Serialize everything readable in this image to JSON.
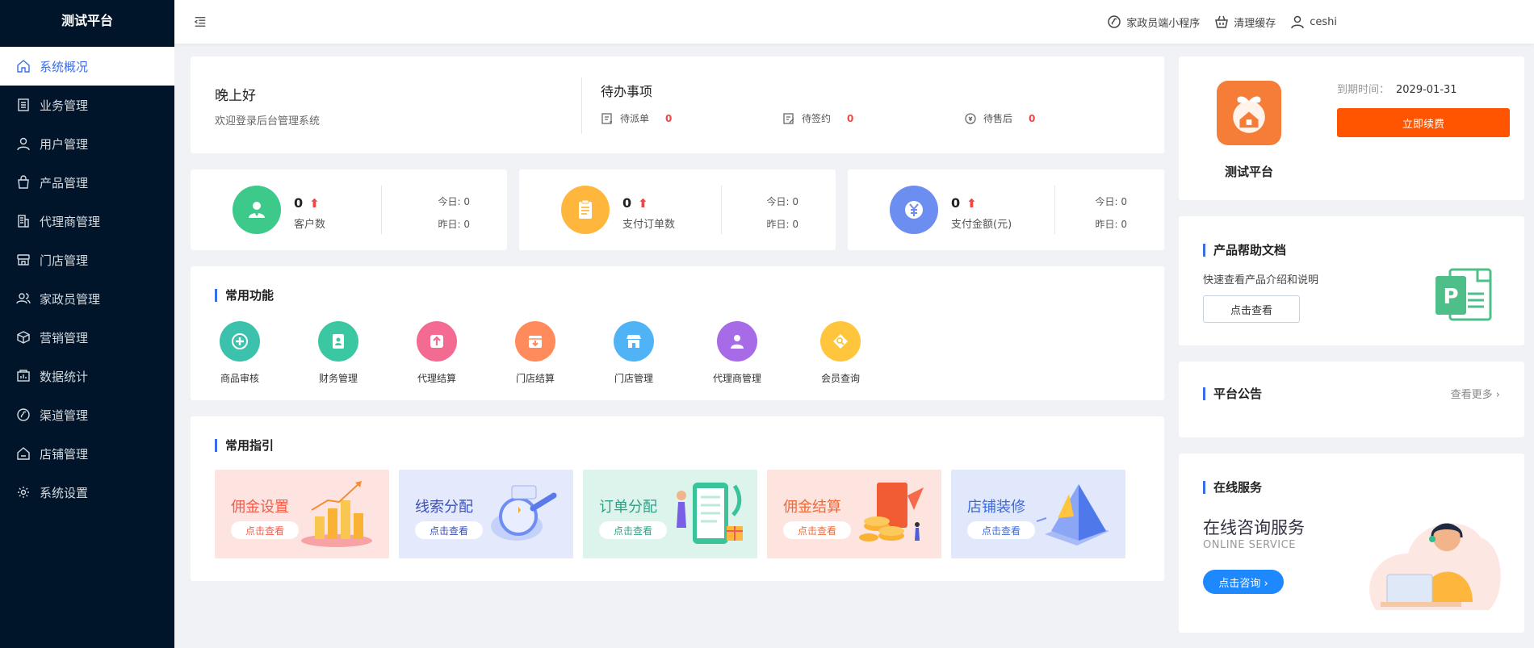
{
  "app": {
    "title": "测试平台"
  },
  "sidebar": {
    "items": [
      {
        "label": "系统概况",
        "icon": "home-icon",
        "active": true
      },
      {
        "label": "业务管理",
        "icon": "list-icon"
      },
      {
        "label": "用户管理",
        "icon": "user-icon"
      },
      {
        "label": "产品管理",
        "icon": "bag-icon"
      },
      {
        "label": "代理商管理",
        "icon": "building-icon"
      },
      {
        "label": "门店管理",
        "icon": "store-icon"
      },
      {
        "label": "家政员管理",
        "icon": "users-icon"
      },
      {
        "label": "营销管理",
        "icon": "cube-icon"
      },
      {
        "label": "数据统计",
        "icon": "chart-box-icon"
      },
      {
        "label": "渠道管理",
        "icon": "channel-icon"
      },
      {
        "label": "店铺管理",
        "icon": "shop-icon"
      },
      {
        "label": "系统设置",
        "icon": "gear-icon"
      }
    ]
  },
  "header": {
    "mini_program": "家政员端小程序",
    "clear_cache": "清理缓存",
    "user": "ceshi"
  },
  "welcome": {
    "greeting": "晚上好",
    "subtitle": "欢迎登录后台管理系统"
  },
  "todo": {
    "title": "待办事项",
    "items": [
      {
        "label": "待派单",
        "count": "0"
      },
      {
        "label": "待签约",
        "count": "0"
      },
      {
        "label": "待售后",
        "count": "0"
      }
    ]
  },
  "stats": [
    {
      "value": "0",
      "label": "客户数",
      "today": "今日: 0",
      "yesterday": "昨日: 0",
      "color": "#3cc98a"
    },
    {
      "value": "0",
      "label": "支付订单数",
      "today": "今日: 0",
      "yesterday": "昨日: 0",
      "color": "#ffb63c"
    },
    {
      "value": "0",
      "label": "支付金额(元)",
      "today": "今日: 0",
      "yesterday": "昨日: 0",
      "color": "#6b8ef0"
    }
  ],
  "functions": {
    "title": "常用功能",
    "items": [
      {
        "label": "商品审核",
        "color": "#3cc1ad"
      },
      {
        "label": "财务管理",
        "color": "#3cc7a3"
      },
      {
        "label": "代理结算",
        "color": "#f46b91"
      },
      {
        "label": "门店结算",
        "color": "#ff8a5c"
      },
      {
        "label": "门店管理",
        "color": "#4fb3f5"
      },
      {
        "label": "代理商管理",
        "color": "#a76be8"
      },
      {
        "label": "会员查询",
        "color": "#ffc53d"
      }
    ]
  },
  "guides": {
    "title": "常用指引",
    "button": "点击查看",
    "items": [
      {
        "label": "佣金设置",
        "bg": "#fde4e1",
        "fg": "#f25c4a"
      },
      {
        "label": "线索分配",
        "bg": "#e4eafc",
        "fg": "#3a4fb8"
      },
      {
        "label": "订单分配",
        "bg": "#dcf4ec",
        "fg": "#2f9f86"
      },
      {
        "label": "佣金结算",
        "bg": "#fde4de",
        "fg": "#ee6a3a"
      },
      {
        "label": "店铺装修",
        "bg": "#e2e8fc",
        "fg": "#3d6bd8"
      }
    ]
  },
  "platform": {
    "name": "测试平台",
    "expire_label": "到期时间：",
    "expire_date": "2029-01-31",
    "renew": "立即续费"
  },
  "help": {
    "title": "产品帮助文档",
    "desc": "快速查看产品介绍和说明",
    "button": "点击查看"
  },
  "notice": {
    "title": "平台公告",
    "more": "查看更多"
  },
  "service": {
    "title": "在线服务",
    "headline": "在线咨询服务",
    "sub": "ONLINE SERVICE",
    "button": "点击咨询"
  }
}
